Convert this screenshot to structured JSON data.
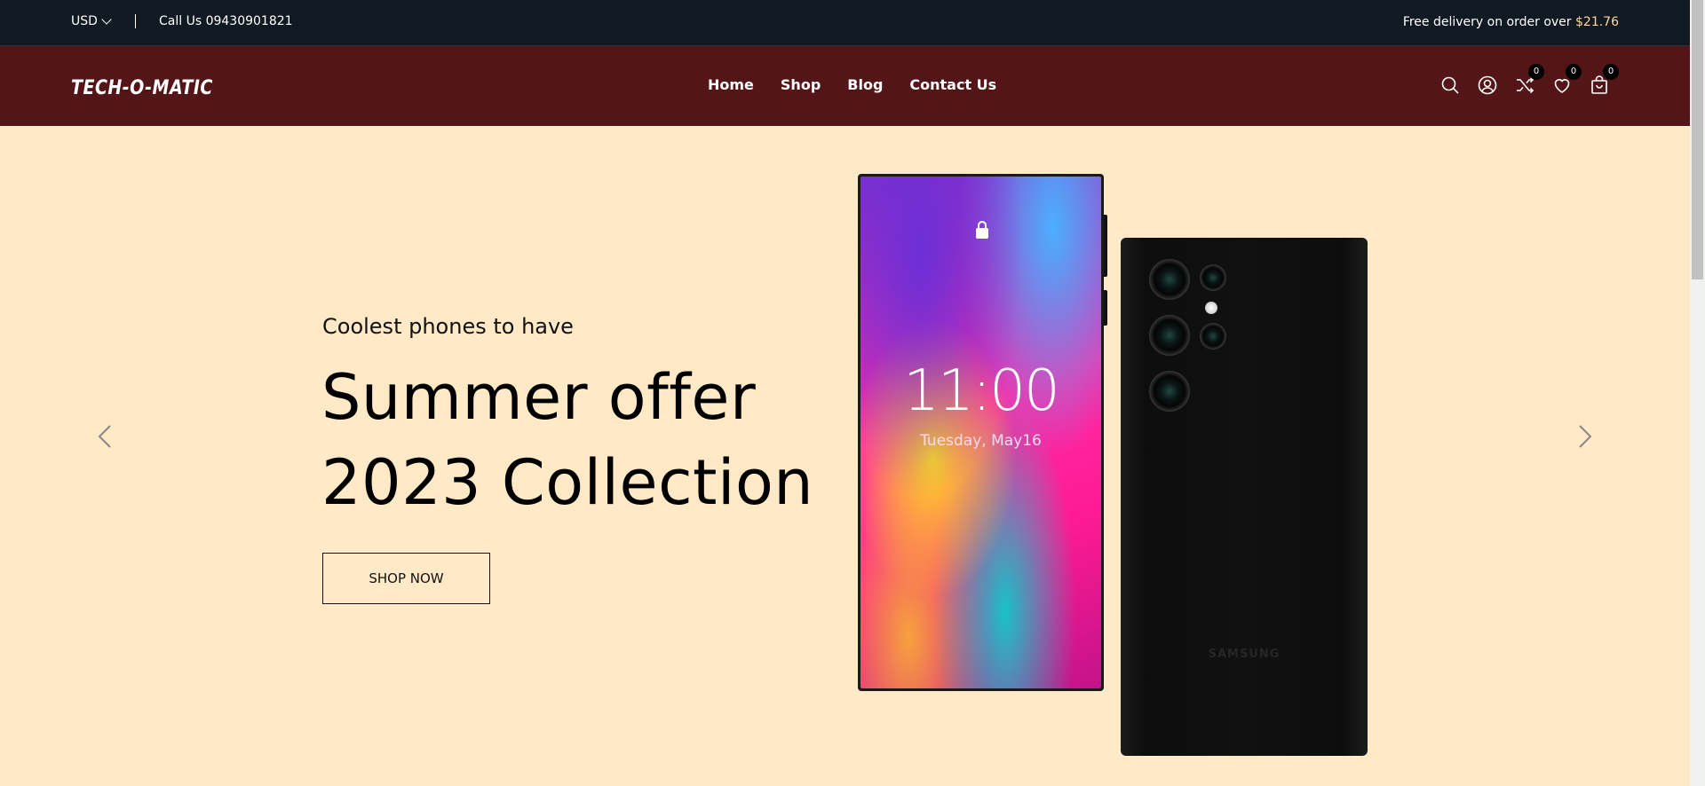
{
  "topbar": {
    "currency": "USD",
    "phone": "Call Us 09430901821",
    "promo_text": "Free delivery on order over",
    "promo_price": "$21.76"
  },
  "header": {
    "logo": "TECH-O-MATIC",
    "nav": [
      "Home",
      "Shop",
      "Blog",
      "Contact Us"
    ],
    "icons": {
      "search": "search-icon",
      "account": "user-icon",
      "compare": "shuffle-icon",
      "wishlist": "heart-icon",
      "cart": "bag-icon"
    },
    "counts": {
      "compare": "0",
      "wishlist": "0",
      "cart": "0"
    }
  },
  "hero": {
    "subtitle": "Coolest phones to have",
    "title_line1": "Summer offer",
    "title_line2": "2023 Collection",
    "button": "SHOP NOW",
    "phone_time": "11:00",
    "phone_date": "Tuesday, May16",
    "brand": "SAMSUNG"
  },
  "colors": {
    "topbar_bg": "#111a22",
    "header_bg": "#531517",
    "hero_bg": "#ffe9c6"
  }
}
